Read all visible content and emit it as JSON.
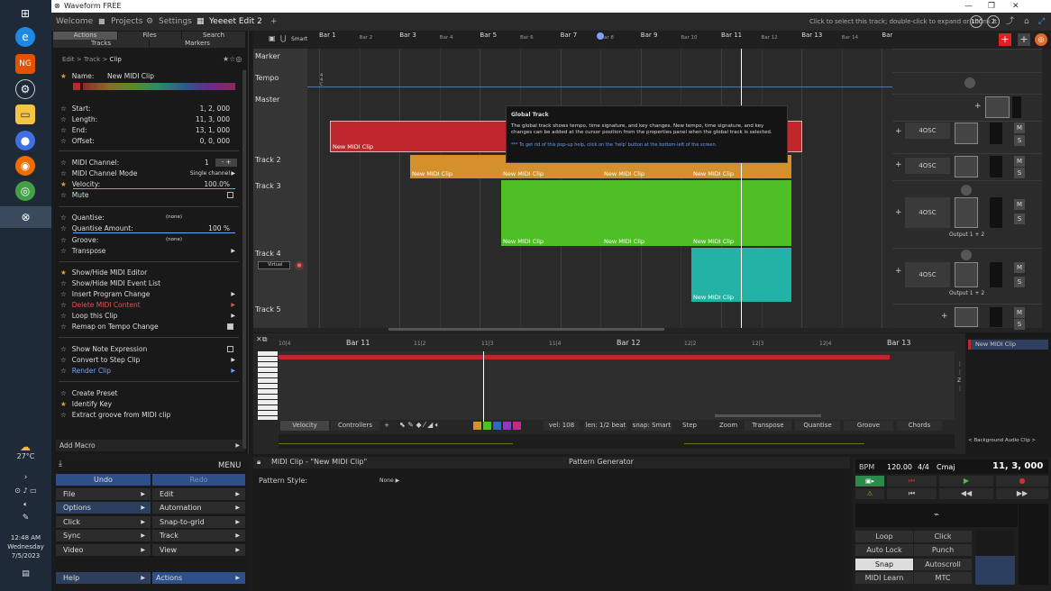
{
  "taskbar": {
    "weather": "27°C",
    "time": "12:48 AM",
    "day": "Wednesday",
    "date": "7/5/2023",
    "notif": "2"
  },
  "title": "Waveform FREE",
  "tabs": [
    "Welcome",
    "Projects",
    "Settings",
    "Yeeeet Edit 2",
    "+"
  ],
  "hint": "Click to select this track; double-click to expand or shrink it",
  "circles": [
    "100",
    "2"
  ],
  "panel_tabs": [
    "Actions",
    "Files",
    "Search",
    "Tracks",
    "Markers"
  ],
  "breadcrumb": [
    "Edit",
    "Track",
    "Clip"
  ],
  "name_label": "Name:",
  "name_value": "New MIDI Clip",
  "timing": [
    [
      "Start:",
      "1, 2, 000"
    ],
    [
      "Length:",
      "11, 3, 000"
    ],
    [
      "End:",
      "13, 1, 000"
    ],
    [
      "Offset:",
      "0, 0, 000"
    ]
  ],
  "midi": {
    "channel_label": "MIDI Channel:",
    "channel": "1",
    "mode_label": "MIDI Channel Mode",
    "mode": "Single channel",
    "velocity_label": "Velocity:",
    "velocity": "100.0%",
    "mute": "Mute"
  },
  "quant": {
    "label": "Quantise:",
    "val": "(none)",
    "amount_label": "Quantise Amount:",
    "amount": "100 %",
    "groove": "Groove:",
    "groove_val": "(none)",
    "transpose": "Transpose"
  },
  "actions": [
    "Show/Hide MIDI Editor",
    "Show/Hide MIDI Event List",
    "Insert Program Change",
    "Delete MIDI Content",
    "Loop this Clip",
    "Remap on Tempo Change"
  ],
  "actions2": [
    "Show Note Expression",
    "Convert to Step Clip",
    "Render Clip"
  ],
  "actions3": [
    "Create Preset",
    "Identify Key",
    "Extract groove from MIDI clip"
  ],
  "add_macro": "Add Macro",
  "menu": {
    "title": "MENU",
    "undo": "Undo",
    "redo": "Redo",
    "items": [
      "File",
      "Edit",
      "Options",
      "Automation",
      "Click",
      "Snap-to-grid",
      "Sync",
      "Track",
      "Video",
      "View",
      "Help",
      "Actions"
    ]
  },
  "smart": "Smart",
  "bars": [
    "Bar 1",
    "Bar 2",
    "Bar 3",
    "Bar 4",
    "Bar 5",
    "Bar 6",
    "Bar 7",
    "Bar 8",
    "Bar 9",
    "Bar 10",
    "Bar 11",
    "Bar 12",
    "Bar 13",
    "Bar 14",
    "Bar"
  ],
  "tracks": [
    "Marker",
    "Tempo",
    "Master",
    "Track 2",
    "Track 3",
    "Track 4",
    "Track 5"
  ],
  "clip_name": "New MIDI Clip",
  "plugin": "4OSC",
  "output": "Output 1 + 2",
  "virtual": "Virtual",
  "tooltip": {
    "title": "Global Track",
    "body": "The global track shows tempo, time signature, and key changes.  New tempo, time signature, and key changes can be added at the cursor position from the properties panel when the global track is selected.",
    "note": "*** To get rid of this pop-up help, click on the 'help' button at the bottom-left of the screen."
  },
  "pr_ruler": [
    "10|4",
    "Bar 11",
    "11|2",
    "11|3",
    "11|4",
    "Bar 12",
    "12|2",
    "12|3",
    "12|4",
    "Bar 13"
  ],
  "pr_bar": [
    "Velocity",
    "Controllers",
    "+",
    "vel: 108",
    "len: 1/2 beat",
    "snap: Smart",
    "Step",
    "Zoom",
    "Transpose",
    "Quantise",
    "Groove",
    "Chords"
  ],
  "side_clip": "New MIDI Clip",
  "side_bg": "< Background Audio Clip >",
  "pattern": {
    "clip": "MIDI Clip - \"New MIDI Clip\"",
    "gen": "Pattern Generator",
    "style_label": "Pattern Style:",
    "style": "None"
  },
  "transport": {
    "bpm_label": "BPM",
    "bpm": "120.00",
    "sig": "4/4",
    "key": "Cmaj",
    "pos": "11, 3, 000",
    "buttons": [
      "Loop",
      "Click",
      "Auto Lock",
      "Punch",
      "Snap",
      "Autoscroll",
      "MIDI Learn",
      "MTC"
    ]
  },
  "colors": {
    "red": "#c0272d",
    "orange": "#d4902a",
    "green": "#4fbf26",
    "teal": "#22b3a6",
    "accent": "#2f4f8a"
  }
}
